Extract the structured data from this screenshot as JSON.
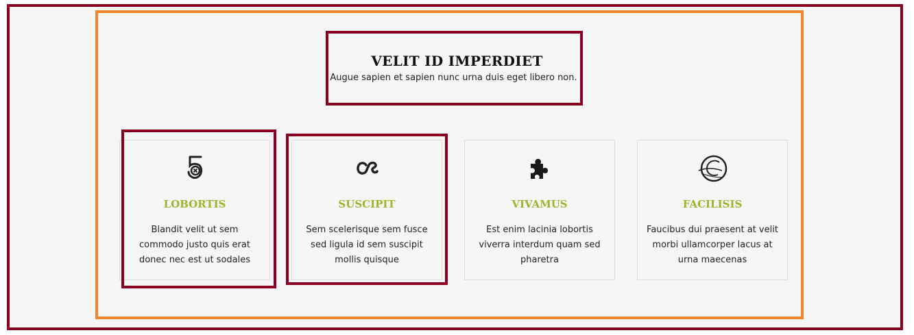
{
  "section": {
    "title": "VELIT ID IMPERDIET",
    "subtitle": "Augue sapien et sapien nunc urna duis eget libero non."
  },
  "cards": [
    {
      "icon": "five-hundred-px-icon",
      "title": "LOBORTIS",
      "text": "Blandit velit ut sem commodo justo quis erat donec nec est ut sodales"
    },
    {
      "icon": "lastfm-icon",
      "title": "SUSCIPIT",
      "text": "Sem scelerisque sem fusce sed ligula id sem suscipit mollis quisque"
    },
    {
      "icon": "puzzle-piece-icon",
      "title": "VIVAMUS",
      "text": "Est enim lacinia lobortis viverra interdum quam sed pharetra"
    },
    {
      "icon": "globe-swirl-icon",
      "title": "FACILISIS",
      "text": "Faucibus dui praesent at velit morbi ullamcorper lacus at urna maecenas"
    }
  ],
  "colors": {
    "highlight_dark": "#8b0022",
    "highlight_orange": "#f5842a",
    "card_title": "#9cb52a",
    "background": "#f7f6f7"
  }
}
